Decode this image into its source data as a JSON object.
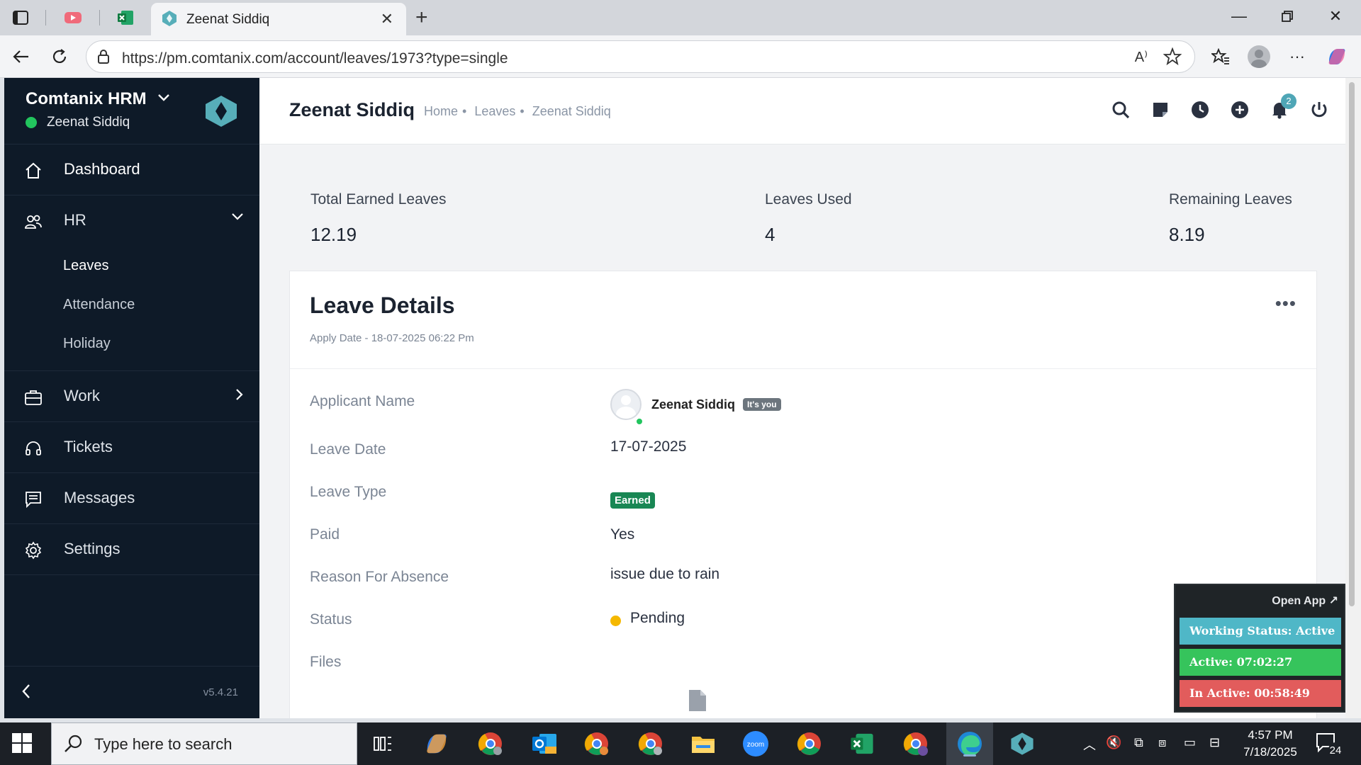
{
  "browser": {
    "tab_title": "Zeenat Siddiq",
    "url": "https://pm.comtanix.com/account/leaves/1973?type=single",
    "read_aloud": "A⁾"
  },
  "sidebar": {
    "brand": "Comtanix HRM",
    "user": "Zeenat Siddiq",
    "items": [
      {
        "label": "Dashboard",
        "icon": "home-icon"
      },
      {
        "label": "HR",
        "icon": "users-icon"
      },
      {
        "label": "Work",
        "icon": "briefcase-icon"
      },
      {
        "label": "Tickets",
        "icon": "headset-icon"
      },
      {
        "label": "Messages",
        "icon": "chat-icon"
      },
      {
        "label": "Settings",
        "icon": "gear-icon"
      }
    ],
    "hr_sub": [
      "Leaves",
      "Attendance",
      "Holiday"
    ],
    "version": "v5.4.21"
  },
  "header": {
    "title": "Zeenat Siddiq",
    "breadcrumb": [
      "Home",
      "Leaves",
      "Zeenat Siddiq"
    ],
    "notif_count": "2"
  },
  "stats": [
    {
      "label": "Total Earned Leaves",
      "value": "12.19"
    },
    {
      "label": "Leaves Used",
      "value": "4"
    },
    {
      "label": "Remaining Leaves",
      "value": "8.19"
    }
  ],
  "card": {
    "title": "Leave Details",
    "subtitle": "Apply Date - 18-07-2025 06:22 Pm",
    "more": "•••",
    "labels": [
      "Applicant Name",
      "Leave Date",
      "Leave Type",
      "Paid",
      "Reason For Absence",
      "Status",
      "Files"
    ],
    "applicant_name": "Zeenat Siddiq",
    "its_you": "It's you",
    "leave_date": "17-07-2025",
    "leave_type": "Earned",
    "paid": "Yes",
    "reason": "issue due to rain",
    "status": "Pending"
  },
  "widget": {
    "open_app": "Open App ↗",
    "working_status": "Working Status: Active",
    "active": "Active: 07:02:27",
    "inactive": "In Active: 00:58:49",
    "colors": {
      "status": "#4fb7c7",
      "active": "#36c45c",
      "inactive": "#e25c5c"
    }
  },
  "taskbar": {
    "search_placeholder": "Type here to search",
    "time": "4:57 PM",
    "date": "7/18/2025",
    "notif_count": "24"
  },
  "colors": {
    "sidebar": "#0e1a28",
    "accent": "#4fa6b6",
    "earned_badge": "#198754",
    "pending": "#f5b800"
  }
}
